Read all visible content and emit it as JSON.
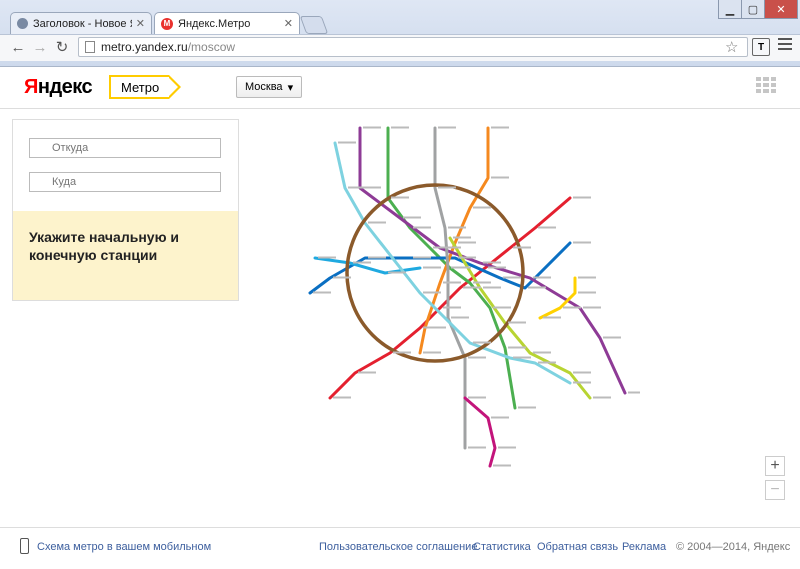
{
  "browser": {
    "tabs": [
      {
        "title": "Заголовок - Новое Яндек",
        "icon": "user-icon",
        "active": false
      },
      {
        "title": "Яндекс.Метро",
        "icon": "metro-icon",
        "active": true
      }
    ],
    "url_host": "metro.yandex.ru",
    "url_path": "/moscow"
  },
  "header": {
    "logo_first": "Я",
    "logo_rest": "ндекс",
    "service": "Метро",
    "city": "Москва",
    "city_arrow": "▾"
  },
  "route": {
    "from_placeholder": "Откуда",
    "to_placeholder": "Куда",
    "hint": "Укажите начальную и конечную станции"
  },
  "map": {
    "ring_color": "#8b5a2b",
    "lines": [
      {
        "color": "#e4202f"
      },
      {
        "color": "#4caf50"
      },
      {
        "color": "#0a6fc2"
      },
      {
        "color": "#1fa9e0"
      },
      {
        "color": "#f5891f"
      },
      {
        "color": "#8e3b96"
      },
      {
        "color": "#ffd100"
      },
      {
        "color": "#a0a2a3"
      },
      {
        "color": "#b8d432"
      },
      {
        "color": "#7ed2e0"
      },
      {
        "color": "#c3147b"
      }
    ]
  },
  "zoom": {
    "plus": "+",
    "minus": "−"
  },
  "footer": {
    "mobile_link": "Схема метро в вашем мобильном",
    "agreement": "Пользовательское соглашение",
    "stats": "Статистика",
    "feedback": "Обратная связь",
    "ads": "Реклама",
    "copyright": "© 2004—2014, Яндекс"
  }
}
